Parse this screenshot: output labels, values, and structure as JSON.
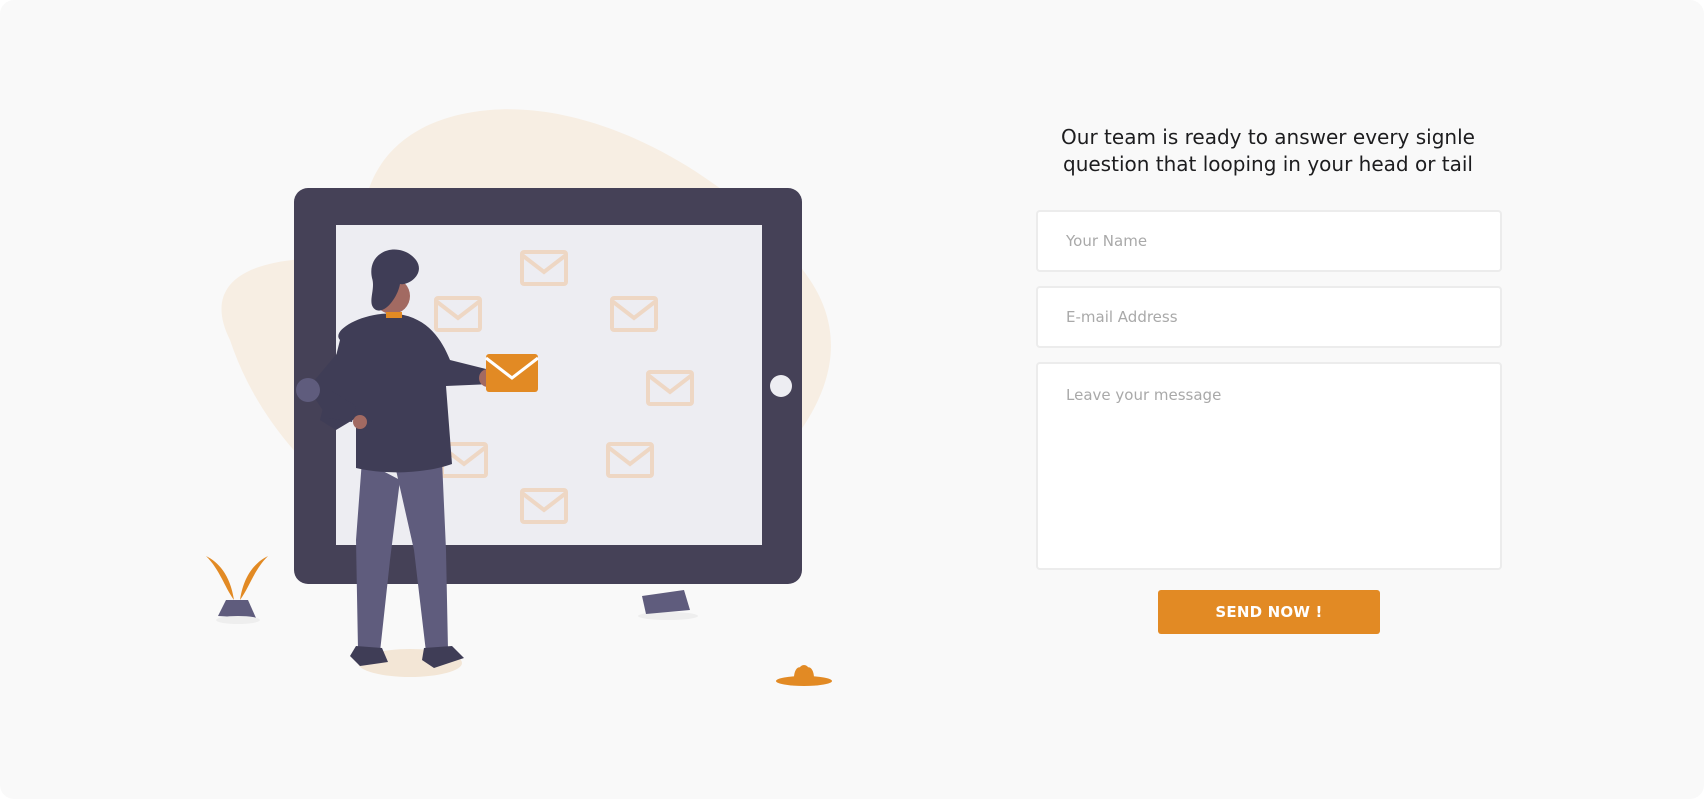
{
  "contact": {
    "heading": "Our team is ready to answer every signle question that looping in your head or tail",
    "name_placeholder": "Your Name",
    "email_placeholder": "E-mail Address",
    "message_placeholder": "Leave your message",
    "send_label": "SEND NOW !"
  },
  "illustration": {
    "icons": [
      "tablet-icon",
      "envelope-icon",
      "person-icon",
      "plant-icon",
      "rock-icon"
    ]
  },
  "colors": {
    "background": "#f9f9f9",
    "accent": "#e28a24",
    "tablet_frame": "#454157",
    "tablet_screen": "#ededf2",
    "blob": "#f7eee3",
    "envelope_outline": "#eed7c4",
    "person_dark": "#3f3d56",
    "person_pants": "#5f5c7d",
    "heading_text": "#1d1d1f"
  }
}
